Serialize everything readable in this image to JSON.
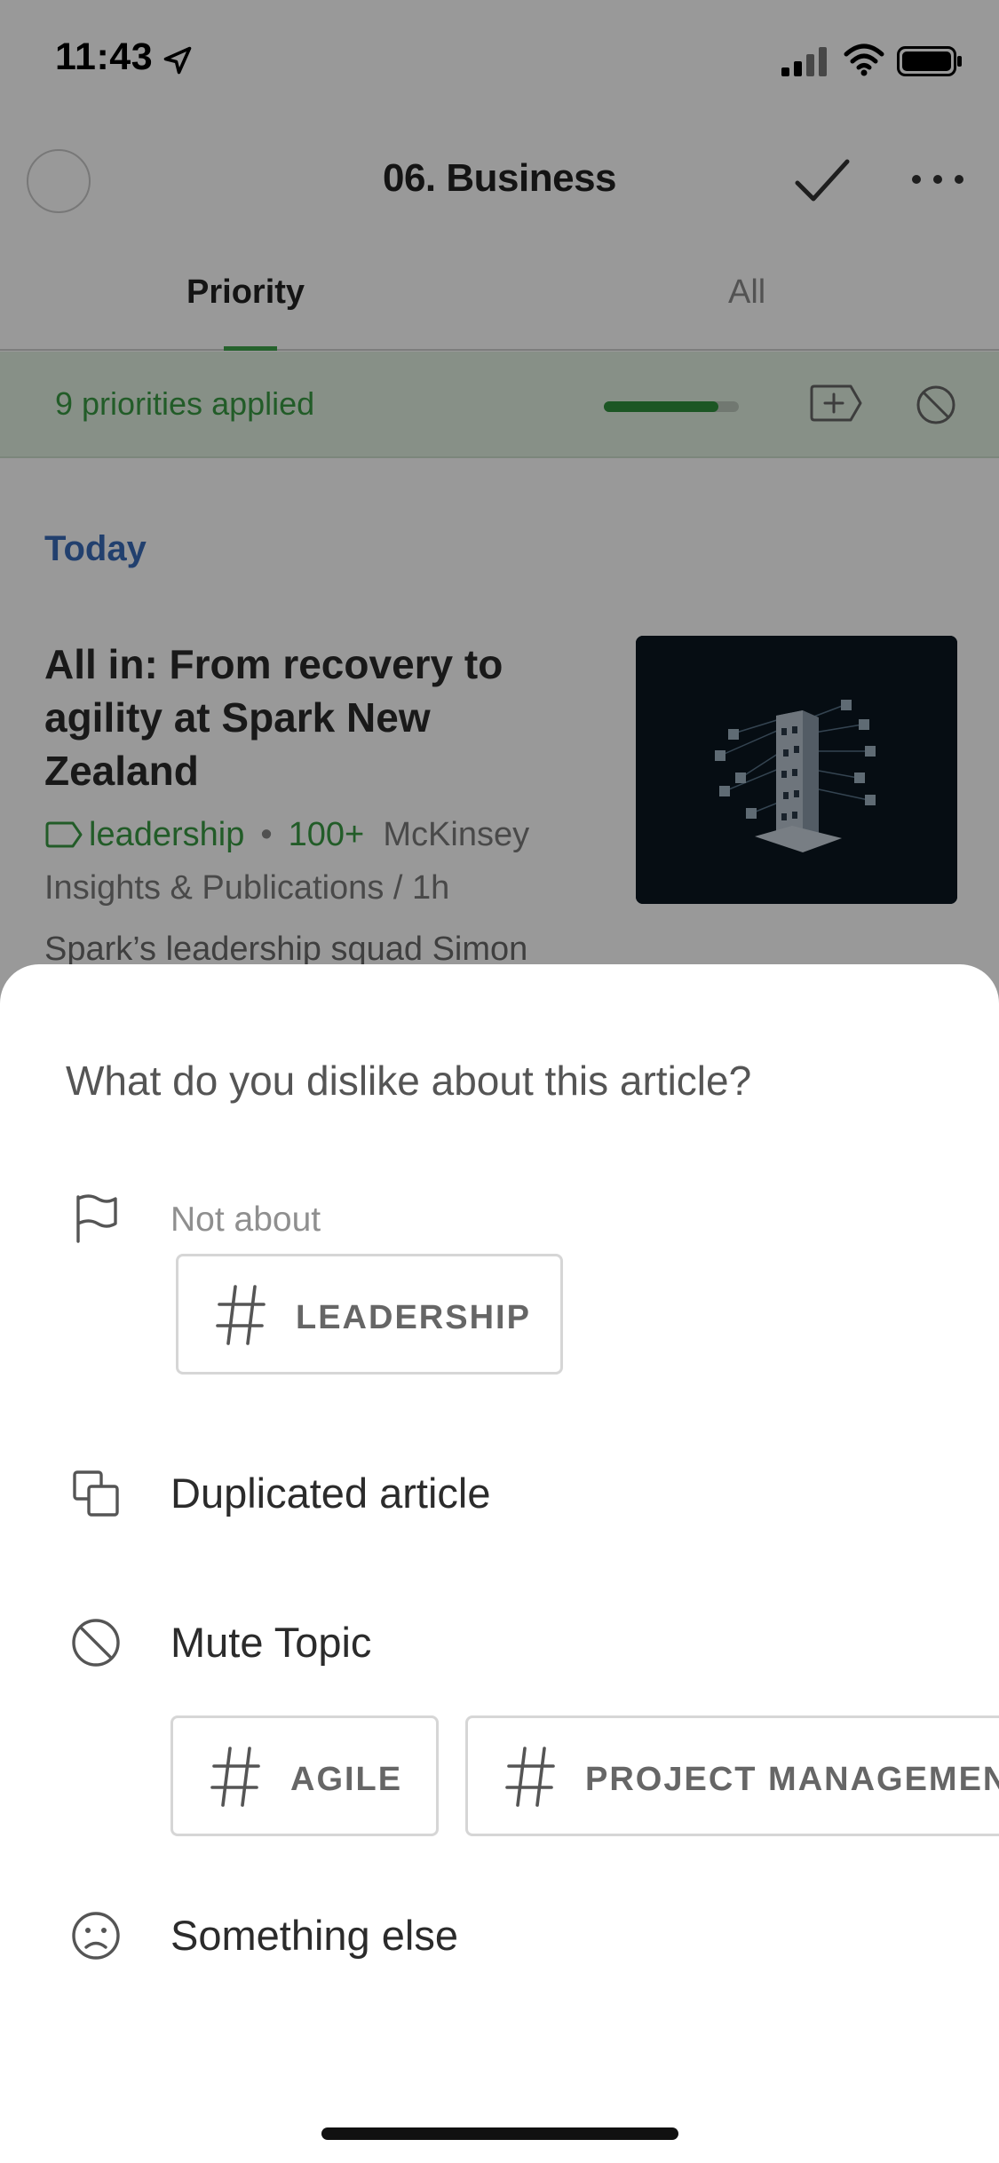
{
  "status_bar": {
    "time": "11:43",
    "icons": [
      "location-arrow-icon",
      "signal-icon",
      "wifi-icon",
      "battery-icon"
    ]
  },
  "header": {
    "title": "06. Business",
    "icons": [
      "avatar-circle",
      "check-icon",
      "more-icon"
    ]
  },
  "tabs": {
    "items": [
      {
        "label": "Priority",
        "active": true
      },
      {
        "label": "All",
        "active": false
      }
    ]
  },
  "priority_bar": {
    "text": "9 priorities applied",
    "progress": 0.85,
    "icons": [
      "tag-plus-icon",
      "ban-icon"
    ]
  },
  "feed": {
    "section_label": "Today",
    "article": {
      "title": "All in: From recovery to agility at Spark New Zealand",
      "tag": "leadership",
      "count": "100+",
      "source": "McKinsey Insights & Publications / 1h",
      "snippet": "Spark’s leadership squad Simon"
    }
  },
  "sheet": {
    "question": "What do you dislike about this article?",
    "not_about": {
      "label": "Not about",
      "chip": "LEADERSHIP"
    },
    "duplicated": {
      "label": "Duplicated article"
    },
    "mute_topic": {
      "label": "Mute Topic",
      "chips": [
        "AGILE",
        "PROJECT MANAGEMENT"
      ]
    },
    "something_else": {
      "label": "Something else"
    }
  },
  "colors": {
    "accent_green": "#3a9a44",
    "today_blue": "#3a6bb8",
    "priority_bg": "#e1f1e1"
  }
}
